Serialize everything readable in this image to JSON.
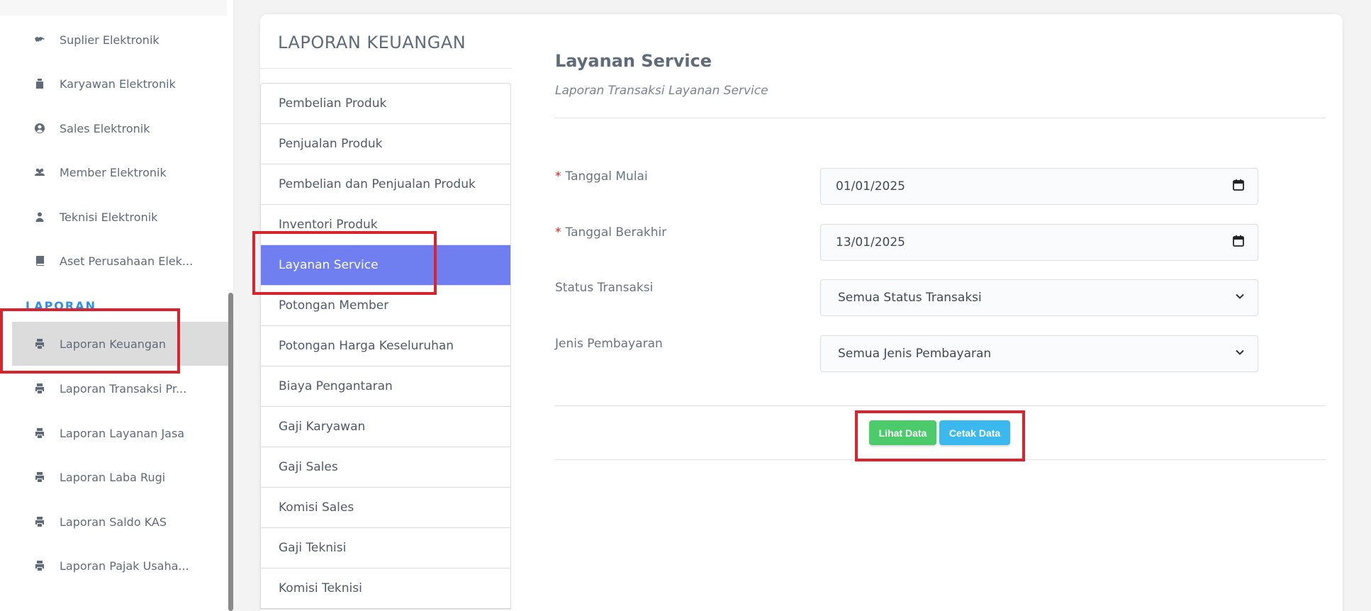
{
  "sidebar": {
    "items": [
      {
        "label": "Suplier Elektronik",
        "icon": "handshake-icon"
      },
      {
        "label": "Karyawan Elektronik",
        "icon": "id-badge-icon"
      },
      {
        "label": "Sales Elektronik",
        "icon": "user-circle-icon"
      },
      {
        "label": "Member Elektronik",
        "icon": "users-icon"
      },
      {
        "label": "Teknisi Elektronik",
        "icon": "user-icon"
      },
      {
        "label": "Aset Perusahaan Elek...",
        "icon": "book-icon"
      }
    ],
    "section_label": "LAPORAN",
    "report_items": [
      {
        "label": "Laporan Keuangan",
        "icon": "printer-icon"
      },
      {
        "label": "Laporan Transaksi Pr...",
        "icon": "printer-icon"
      },
      {
        "label": "Laporan Layanan Jasa",
        "icon": "printer-icon"
      },
      {
        "label": "Laporan Laba Rugi",
        "icon": "printer-icon"
      },
      {
        "label": "Laporan Saldo KAS",
        "icon": "printer-icon"
      },
      {
        "label": "Laporan Pajak Usaha...",
        "icon": "printer-icon"
      }
    ],
    "active_item": "Laporan Keuangan"
  },
  "report_menu": {
    "title": "LAPORAN KEUANGAN",
    "items": [
      "Pembelian Produk",
      "Penjualan Produk",
      "Pembelian dan Penjualan Produk",
      "Inventori Produk",
      "Layanan Service",
      "Potongan Member",
      "Potongan Harga Keseluruhan",
      "Biaya Pengantaran",
      "Gaji Karyawan",
      "Gaji Sales",
      "Komisi Sales",
      "Gaji Teknisi",
      "Komisi Teknisi"
    ],
    "active_item": "Layanan Service"
  },
  "form": {
    "title": "Layanan Service",
    "subtitle": "Laporan Transaksi Layanan Service",
    "required_mark": "*",
    "start_date": {
      "label": "Tanggal Mulai",
      "value": "01/01/2025"
    },
    "end_date": {
      "label": "Tanggal Berakhir",
      "value": "13/01/2025"
    },
    "status": {
      "label": "Status Transaksi",
      "value": "Semua Status Transaksi"
    },
    "payment": {
      "label": "Jenis Pembayaran",
      "value": "Semua Jenis Pembayaran"
    },
    "view_button": "Lihat Data",
    "print_button": "Cetak Data"
  },
  "colors": {
    "accent": "#6f7ff0",
    "section": "#2f8ee8",
    "green_button": "#4ccb6a",
    "blue_button": "#3bb9ef",
    "highlight": "#d9232d"
  }
}
